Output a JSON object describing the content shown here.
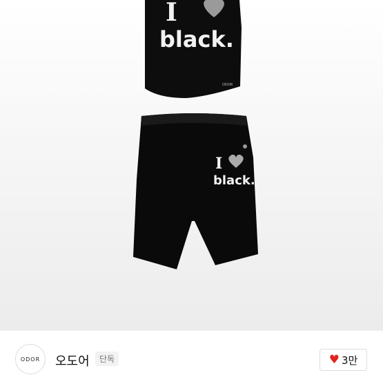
{
  "product": {
    "top_print_line1": "I",
    "top_print_line2": "black.",
    "top_tag": "ODOR",
    "shorts_print_line1": "I",
    "shorts_print_line2": "black."
  },
  "footer": {
    "logo_text": "ODOR",
    "brand_name": "오도어",
    "badge": "단독",
    "like_count": "3만",
    "like_icon": "heart-icon",
    "like_color": "#e0241b"
  }
}
